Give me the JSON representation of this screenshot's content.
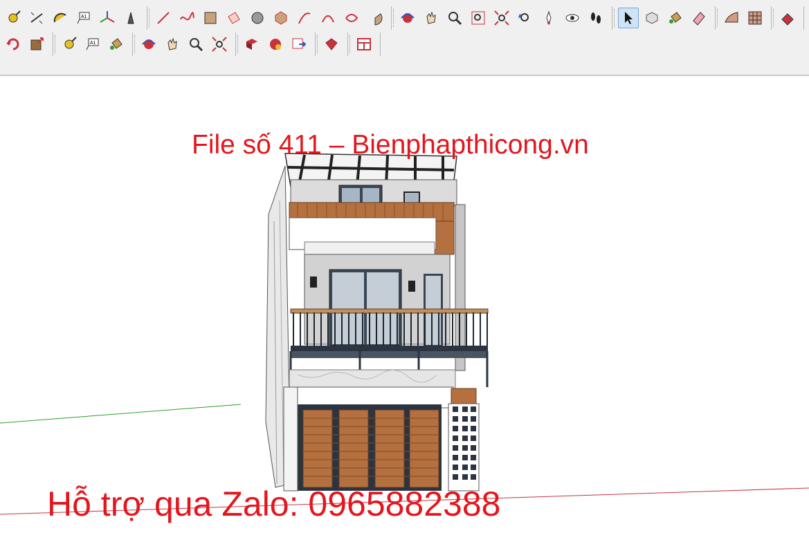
{
  "toolbar": {
    "row1": [
      {
        "group": "construction",
        "items": [
          "tape-measure-icon",
          "dimension-icon",
          "protractor-icon",
          "text-label-icon",
          "axes-icon",
          "3d-text-icon"
        ]
      },
      {
        "group": "drawing",
        "items": [
          "line-icon",
          "freehand-icon",
          "rectangle-icon",
          "rotated-rectangle-icon",
          "circle-icon",
          "polygon-icon",
          "arc-icon",
          "two-point-arc-icon",
          "three-point-arc-icon",
          "pie-icon"
        ]
      },
      {
        "group": "camera",
        "items": [
          "orbit-icon",
          "pan-icon",
          "zoom-icon",
          "zoom-window-icon",
          "zoom-extents-icon",
          "previous-view-icon",
          "position-camera-icon",
          "look-around-icon",
          "walk-icon"
        ]
      },
      {
        "group": "principal",
        "items": [
          "select-icon",
          "make-component-icon",
          "paint-bucket-icon",
          "eraser-icon"
        ]
      },
      {
        "group": "sandbox",
        "items": [
          "sandbox-contours-icon",
          "sandbox-scratch-icon"
        ]
      },
      {
        "group": "misc",
        "items": [
          "stamp-icon"
        ]
      }
    ],
    "row2": [
      {
        "group": "edit",
        "items": [
          "rotate-icon",
          "push-pull-icon"
        ]
      },
      {
        "group": "construction-2",
        "items": [
          "tape-measure-icon",
          "text-label-icon",
          "paint-bucket-icon"
        ]
      },
      {
        "group": "camera-2",
        "items": [
          "orbit-icon",
          "pan-icon",
          "zoom-icon",
          "zoom-extents-icon"
        ]
      },
      {
        "group": "warehouse",
        "items": [
          "3d-warehouse-icon",
          "share-component-icon",
          "extension-warehouse-icon"
        ]
      },
      {
        "group": "ruby",
        "items": [
          "ruby-console-icon"
        ]
      },
      {
        "group": "layout",
        "items": [
          "send-to-layout-icon"
        ]
      }
    ],
    "active_tool": "select-icon"
  },
  "viewport": {
    "title_overlay": "File số 411 – Bienphapthicong.vn",
    "support_overlay": "Hỗ trợ qua Zalo: 0965882388"
  },
  "colors": {
    "overlay_text": "#e4151d",
    "toolbar_bg": "#f0f0f0",
    "green_axis": "#2f9e2f",
    "red_axis": "#c8323c",
    "wood": "#b5703f",
    "frame_dark": "#2b3440"
  }
}
